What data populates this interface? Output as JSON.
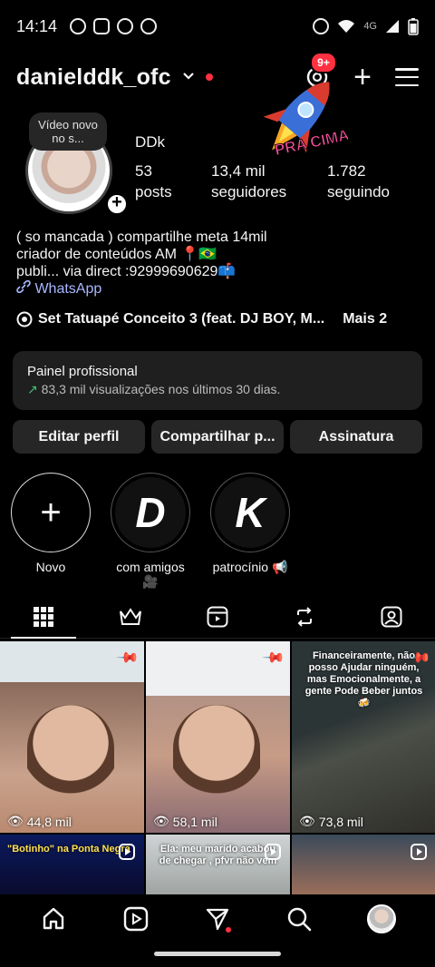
{
  "status_bar": {
    "time": "14:14",
    "network": "4G"
  },
  "header": {
    "username": "danielddk_ofc",
    "notification_badge": "9+"
  },
  "sticker": {
    "text": "PRA CIMA"
  },
  "profile": {
    "note": "Vídeo novo no s...",
    "display_name": "DDk",
    "stats": [
      {
        "value": "53",
        "label": "posts"
      },
      {
        "value": "13,4 mil",
        "label": "seguidores"
      },
      {
        "value": "1.782",
        "label": "seguindo"
      }
    ],
    "bio": {
      "line1": "( so mancada ) compartilhe meta 14mil",
      "line2": "criador de conteúdos AM 📍🇧🇷",
      "line3": "publi... via direct :92999690629📫",
      "link": "WhatsApp"
    },
    "music": {
      "track": "Set Tatuapé Conceito 3 (feat. DJ BOY, M...",
      "more": "Mais 2"
    }
  },
  "panel": {
    "title": "Painel profissional",
    "subtitle": "83,3 mil visualizações nos últimos 30 dias."
  },
  "actions": {
    "edit": "Editar perfil",
    "share": "Compartilhar p...",
    "subscription": "Assinatura"
  },
  "highlights": [
    {
      "label": "Novo",
      "letter": "+"
    },
    {
      "label": "com amigos 🎥",
      "letter": "D"
    },
    {
      "label": "patrocínio 📢",
      "letter": "K"
    }
  ],
  "posts": [
    {
      "views": "44,8 mil",
      "caption": ""
    },
    {
      "views": "58,1 mil",
      "caption": ""
    },
    {
      "views": "73,8 mil",
      "caption": "Financeiramente, não posso Ajudar ninguém, mas Emocionalmente, a gente Pode Beber juntos🍻"
    },
    {
      "views": "",
      "caption": "\"Botinho\" na Ponta Negra"
    },
    {
      "views": "",
      "caption": "Ela: meu marido acabou de chegar , pfvr não vem"
    },
    {
      "views": "",
      "caption": ""
    }
  ],
  "colors": {
    "background": "#000000",
    "button_bg": "#262626",
    "accent_red": "#ff3040",
    "link": "#a9b8ff",
    "growth_green": "#3ec46d"
  }
}
